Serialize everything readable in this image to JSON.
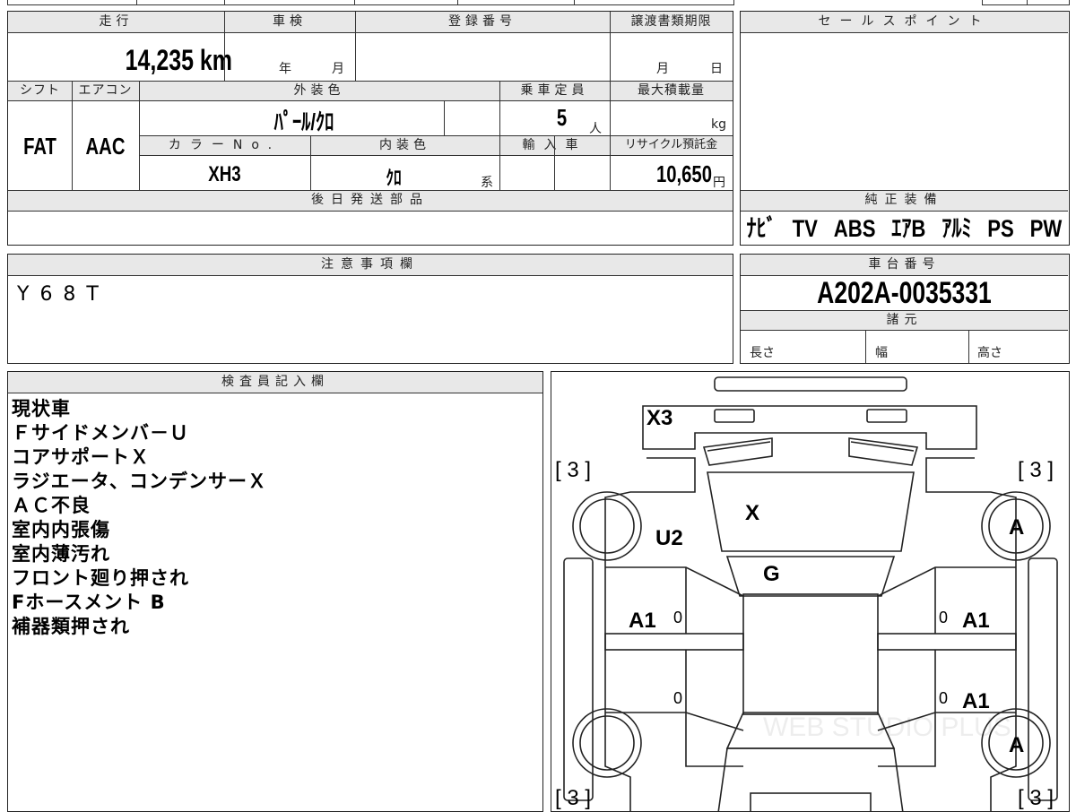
{
  "mileage": {
    "header": "走行",
    "value": "14,235 km"
  },
  "inspection": {
    "header": "車検",
    "year_unit": "年",
    "month_unit": "月"
  },
  "registration": {
    "header": "登録番号"
  },
  "transfer": {
    "header": "譲渡書類期限",
    "month_unit": "月",
    "day_unit": "日"
  },
  "sales_point": {
    "header": "セールスポイント"
  },
  "shift": {
    "header": "シフト",
    "value": "FAT"
  },
  "aircon": {
    "header": "エアコン",
    "value": "AAC"
  },
  "exterior_color": {
    "header": "外装色",
    "value": "ﾊﾟｰﾙ/ｸﾛ"
  },
  "capacity": {
    "header": "乗車定員",
    "value": "5",
    "unit": "人"
  },
  "max_load": {
    "header": "最大積載量",
    "unit": "kg"
  },
  "color_no": {
    "header": "カラーNo.",
    "value": "XH3"
  },
  "interior_color": {
    "header": "内装色",
    "value": "ｸﾛ",
    "unit": "系"
  },
  "import": {
    "header": "輸入車"
  },
  "recycle": {
    "header": "リサイクル預託金",
    "value": "10,650",
    "unit": "円"
  },
  "later_parts": {
    "header": "後日発送部品"
  },
  "genuine_equipment": {
    "header": "純正装備",
    "items": [
      "ﾅﾋﾞ",
      "TV",
      "ABS",
      "ｴｱB",
      "ｱﾙﾐ",
      "PS",
      "PW"
    ]
  },
  "caution": {
    "header": "注意事項欄",
    "value": "Y68T"
  },
  "chassis": {
    "header": "車台番号",
    "value": "A202A-0035331"
  },
  "specs": {
    "header": "諸元",
    "length": "長さ",
    "width": "幅",
    "height": "高さ"
  },
  "inspector": {
    "header": "検査員記入欄",
    "lines": [
      "現状車",
      "Ｆサイドメンバ－Ｕ",
      "コアサポートＸ",
      "ラジエータ、コンデンサーＸ",
      "ＡＣ不良",
      "室内内張傷",
      "室内薄汚れ",
      "フロント廻り押され",
      "Fホースメント B",
      "補器類押され"
    ]
  },
  "diagram": {
    "labels": {
      "front": "X3",
      "bonnet": "X",
      "fender_left": "U2",
      "windshield": "G",
      "door_front_left": "A1",
      "door_front_right": "A1",
      "door_rear_right": "A1",
      "wheel_front_right": "A",
      "wheel_rear_right": "A",
      "tire_fl": "[ 3 ]",
      "tire_fr": "[ 3 ]",
      "tire_rl": "[ 3 ]",
      "tire_rr": "[ 3 ]",
      "zero_1": "0",
      "zero_2": "0",
      "zero_3": "0",
      "zero_4": "0"
    },
    "watermark": "WEB STUDIO PLUS"
  }
}
